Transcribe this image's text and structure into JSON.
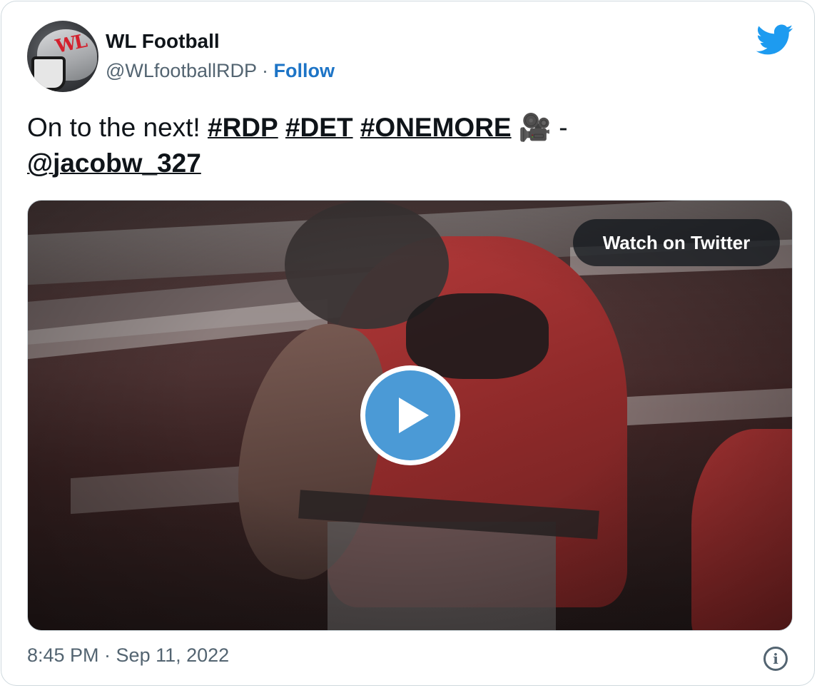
{
  "author": {
    "name": "WL Football",
    "handle": "@WLfootballRDP",
    "separator": "·",
    "follow_label": "Follow",
    "avatar_logo_text": "WL"
  },
  "tweet": {
    "text_start": "On to the next!",
    "hashtags": [
      "#RDP",
      "#DET",
      "#ONEMORE"
    ],
    "emoji": "🎥",
    "dash": "-",
    "mention": "@jacobw_327"
  },
  "media": {
    "watch_label": "Watch on Twitter",
    "play_icon": "play-icon"
  },
  "footer": {
    "timestamp": "8:45 PM · Sep 11, 2022",
    "info_glyph": "i"
  },
  "icons": {
    "brand": "twitter-bird-icon",
    "info": "info-icon"
  },
  "colors": {
    "twitter_blue": "#1d9bf0",
    "follow_blue": "#1d74c6",
    "play_blue": "#4b9ad6",
    "text": "#0f1419",
    "secondary": "#536471"
  }
}
